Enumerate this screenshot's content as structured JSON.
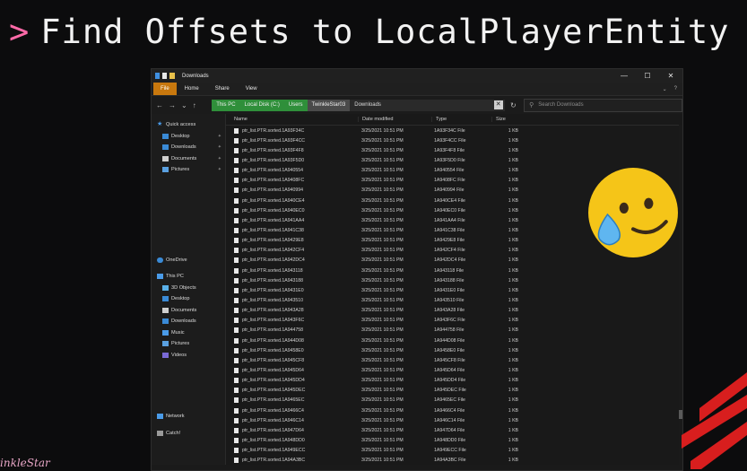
{
  "slide": {
    "chevron": ">",
    "title": "Find Offsets to LocalPlayerEntity"
  },
  "window": {
    "title": "Downloads",
    "controls": {
      "minimize": "—",
      "maximize": "☐",
      "close": "✕"
    }
  },
  "ribbon": {
    "tabs": [
      "File",
      "Home",
      "Share",
      "View"
    ]
  },
  "address": {
    "crumbs": [
      "This PC",
      "Local Disk (C:)",
      "Users",
      "TwinkleStar03",
      "Downloads"
    ],
    "search_placeholder": "Search Downloads"
  },
  "sidebar": {
    "quick_access": "Quick access",
    "quick_items": [
      "Desktop",
      "Downloads",
      "Documents",
      "Pictures"
    ],
    "onedrive": "OneDrive",
    "this_pc": "This PC",
    "pc_items": [
      "3D Objects",
      "Desktop",
      "Documents",
      "Downloads",
      "Music",
      "Pictures",
      "Videos"
    ],
    "network": "Network",
    "catch": "Catch!"
  },
  "columns": {
    "name": "Name",
    "date": "Date modified",
    "type": "Type",
    "size": "Size"
  },
  "files": [
    {
      "name": "ptr_list.PTR.sorted.1A93F34C",
      "date": "3/25/2021 10:51 PM",
      "type": "1A93F34C File",
      "size": "1 KB"
    },
    {
      "name": "ptr_list.PTR.sorted.1A93F4CC",
      "date": "3/25/2021 10:51 PM",
      "type": "1A93F4CC File",
      "size": "1 KB"
    },
    {
      "name": "ptr_list.PTR.sorted.1A93F4F8",
      "date": "3/25/2021 10:51 PM",
      "type": "1A93F4F8 File",
      "size": "1 KB"
    },
    {
      "name": "ptr_list.PTR.sorted.1A93F5D0",
      "date": "3/25/2021 10:51 PM",
      "type": "1A93F5D0 File",
      "size": "1 KB"
    },
    {
      "name": "ptr_list.PTR.sorted.1A940554",
      "date": "3/25/2021 10:51 PM",
      "type": "1A940554 File",
      "size": "1 KB"
    },
    {
      "name": "ptr_list.PTR.sorted.1A9408FC",
      "date": "3/25/2021 10:51 PM",
      "type": "1A9408FC File",
      "size": "1 KB"
    },
    {
      "name": "ptr_list.PTR.sorted.1A940994",
      "date": "3/25/2021 10:51 PM",
      "type": "1A940994 File",
      "size": "1 KB"
    },
    {
      "name": "ptr_list.PTR.sorted.1A940CE4",
      "date": "3/25/2021 10:51 PM",
      "type": "1A940CE4 File",
      "size": "1 KB"
    },
    {
      "name": "ptr_list.PTR.sorted.1A940EC0",
      "date": "3/25/2021 10:51 PM",
      "type": "1A940EC0 File",
      "size": "1 KB"
    },
    {
      "name": "ptr_list.PTR.sorted.1A941AA4",
      "date": "3/25/2021 10:51 PM",
      "type": "1A941AA4 File",
      "size": "1 KB"
    },
    {
      "name": "ptr_list.PTR.sorted.1A941C38",
      "date": "3/25/2021 10:51 PM",
      "type": "1A941C38 File",
      "size": "1 KB"
    },
    {
      "name": "ptr_list.PTR.sorted.1A9429E8",
      "date": "3/25/2021 10:51 PM",
      "type": "1A9429E8 File",
      "size": "1 KB"
    },
    {
      "name": "ptr_list.PTR.sorted.1A942CF4",
      "date": "3/25/2021 10:51 PM",
      "type": "1A942CF4 File",
      "size": "1 KB"
    },
    {
      "name": "ptr_list.PTR.sorted.1A942DC4",
      "date": "3/25/2021 10:51 PM",
      "type": "1A942DC4 File",
      "size": "1 KB"
    },
    {
      "name": "ptr_list.PTR.sorted.1A943118",
      "date": "3/25/2021 10:51 PM",
      "type": "1A943118 File",
      "size": "1 KB"
    },
    {
      "name": "ptr_list.PTR.sorted.1A943188",
      "date": "3/25/2021 10:51 PM",
      "type": "1A943188 File",
      "size": "1 KB"
    },
    {
      "name": "ptr_list.PTR.sorted.1A9431E0",
      "date": "3/25/2021 10:51 PM",
      "type": "1A9431E0 File",
      "size": "1 KB"
    },
    {
      "name": "ptr_list.PTR.sorted.1A943510",
      "date": "3/25/2021 10:51 PM",
      "type": "1A943510 File",
      "size": "1 KB"
    },
    {
      "name": "ptr_list.PTR.sorted.1A943A28",
      "date": "3/25/2021 10:51 PM",
      "type": "1A943A28 File",
      "size": "1 KB"
    },
    {
      "name": "ptr_list.PTR.sorted.1A943F6C",
      "date": "3/25/2021 10:51 PM",
      "type": "1A943F6C File",
      "size": "1 KB"
    },
    {
      "name": "ptr_list.PTR.sorted.1A944758",
      "date": "3/25/2021 10:51 PM",
      "type": "1A944758 File",
      "size": "1 KB"
    },
    {
      "name": "ptr_list.PTR.sorted.1A944D08",
      "date": "3/25/2021 10:51 PM",
      "type": "1A944D08 File",
      "size": "1 KB"
    },
    {
      "name": "ptr_list.PTR.sorted.1A9458E0",
      "date": "3/25/2021 10:51 PM",
      "type": "1A9458E0 File",
      "size": "1 KB"
    },
    {
      "name": "ptr_list.PTR.sorted.1A945CF8",
      "date": "3/25/2021 10:51 PM",
      "type": "1A945CF8 File",
      "size": "1 KB"
    },
    {
      "name": "ptr_list.PTR.sorted.1A945D64",
      "date": "3/25/2021 10:51 PM",
      "type": "1A945D64 File",
      "size": "1 KB"
    },
    {
      "name": "ptr_list.PTR.sorted.1A945DD4",
      "date": "3/25/2021 10:51 PM",
      "type": "1A945DD4 File",
      "size": "1 KB"
    },
    {
      "name": "ptr_list.PTR.sorted.1A945DEC",
      "date": "3/25/2021 10:51 PM",
      "type": "1A945DEC File",
      "size": "1 KB"
    },
    {
      "name": "ptr_list.PTR.sorted.1A9465EC",
      "date": "3/25/2021 10:51 PM",
      "type": "1A9465EC File",
      "size": "1 KB"
    },
    {
      "name": "ptr_list.PTR.sorted.1A9466C4",
      "date": "3/25/2021 10:51 PM",
      "type": "1A9466C4 File",
      "size": "1 KB"
    },
    {
      "name": "ptr_list.PTR.sorted.1A946C14",
      "date": "3/25/2021 10:51 PM",
      "type": "1A946C14 File",
      "size": "1 KB"
    },
    {
      "name": "ptr_list.PTR.sorted.1A947D64",
      "date": "3/25/2021 10:51 PM",
      "type": "1A947D64 File",
      "size": "1 KB"
    },
    {
      "name": "ptr_list.PTR.sorted.1A948DD0",
      "date": "3/25/2021 10:51 PM",
      "type": "1A948DD0 File",
      "size": "1 KB"
    },
    {
      "name": "ptr_list.PTR.sorted.1A949ECC",
      "date": "3/25/2021 10:51 PM",
      "type": "1A949ECC File",
      "size": "1 KB"
    },
    {
      "name": "ptr_list.PTR.sorted.1A94A3BC",
      "date": "3/25/2021 10:51 PM",
      "type": "1A94A3BC File",
      "size": "1 KB"
    }
  ],
  "watermark": "inkleStar",
  "colors": {
    "accent_green": "#2f8f3a",
    "file_tab": "#c8780e",
    "title_chevron": "#ff6aa8",
    "stripes": "#d81e1e"
  }
}
